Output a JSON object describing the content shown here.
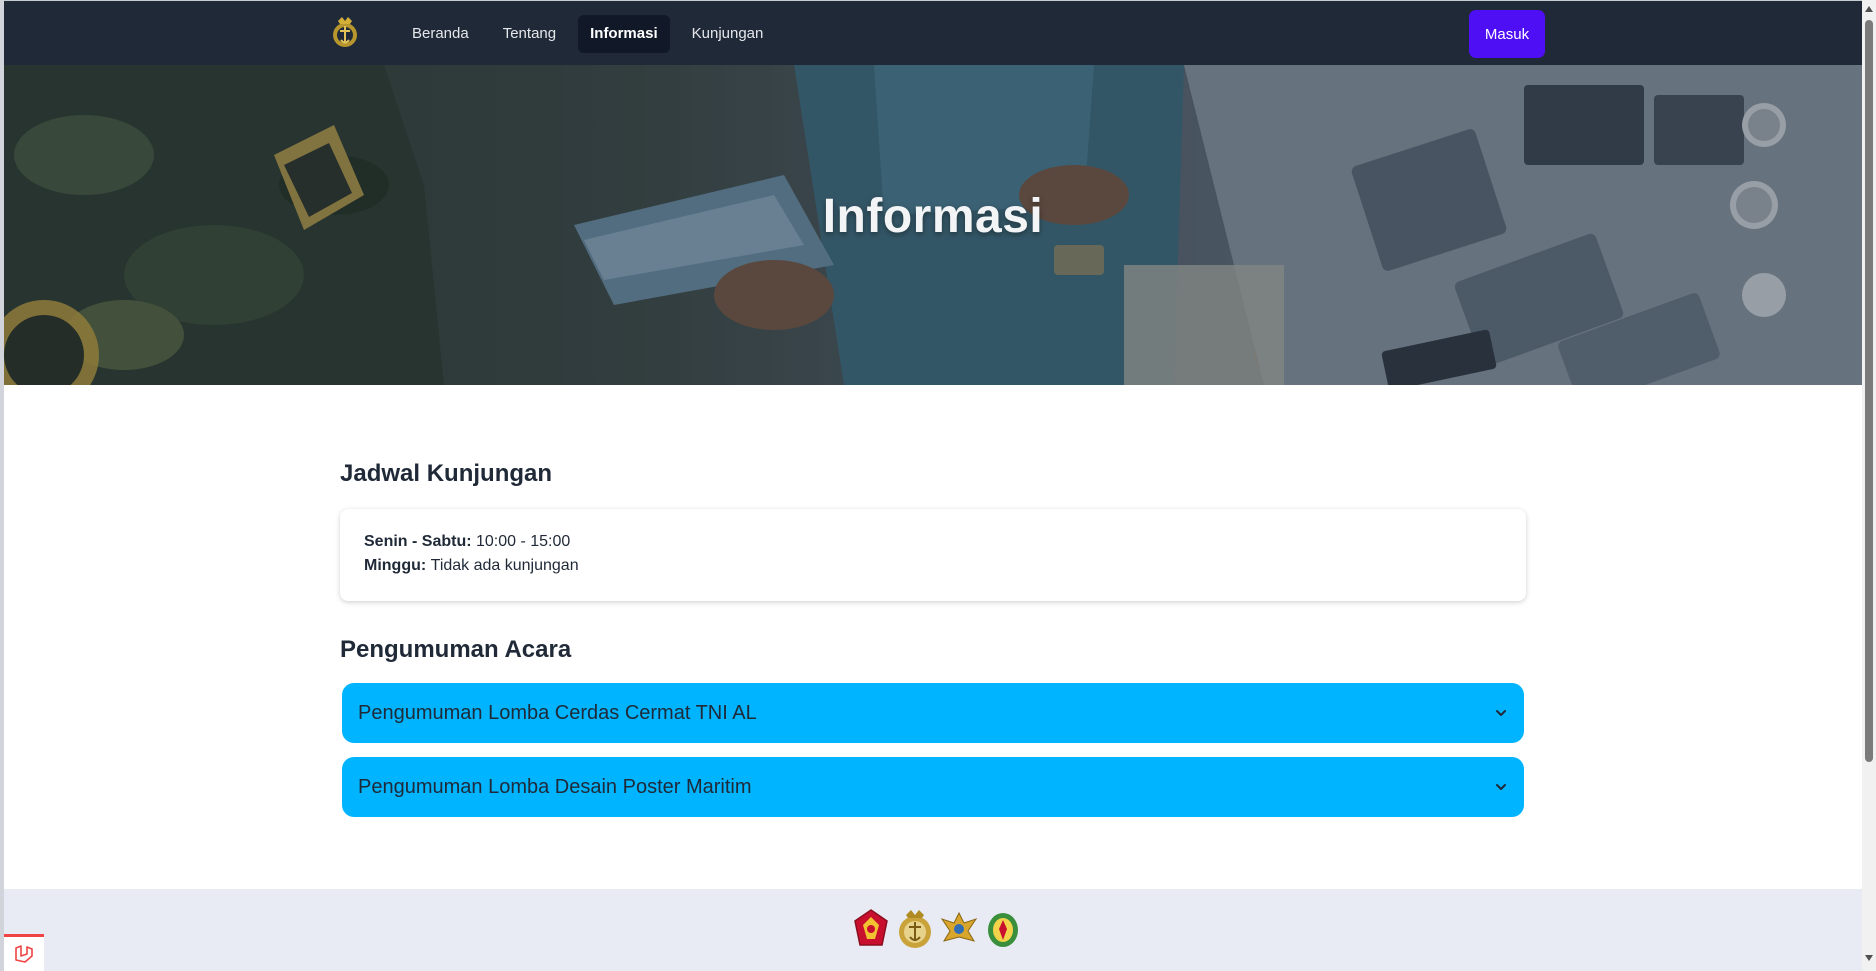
{
  "nav": {
    "logo_icon": "navy-emblem-icon",
    "links": [
      {
        "label": "Beranda",
        "active": false
      },
      {
        "label": "Tentang",
        "active": false
      },
      {
        "label": "Informasi",
        "active": true
      },
      {
        "label": "Kunjungan",
        "active": false
      }
    ],
    "login_label": "Masuk",
    "login_color": "#4f0ff5",
    "bg_color": "#1f2937"
  },
  "hero": {
    "title": "Informasi"
  },
  "schedule": {
    "title": "Jadwal Kunjungan",
    "rows": [
      {
        "label": "Senin - Sabtu:",
        "value": "10:00 - 15:00"
      },
      {
        "label": "Minggu:",
        "value": "Tidak ada kunjungan"
      }
    ]
  },
  "announcements": {
    "title": "Pengumuman Acara",
    "accent_color": "#00b4ff",
    "items": [
      {
        "label": "Pengumuman Lomba Cerdas Cermat TNI AL",
        "icon": "chevron-down-icon"
      },
      {
        "label": "Pengumuman Lomba Desain Poster Maritim",
        "icon": "chevron-down-icon"
      }
    ]
  },
  "footer": {
    "emblems": [
      "tni-emblem-icon",
      "navy-emblem-icon",
      "air-force-emblem-icon",
      "army-emblem-icon"
    ]
  }
}
